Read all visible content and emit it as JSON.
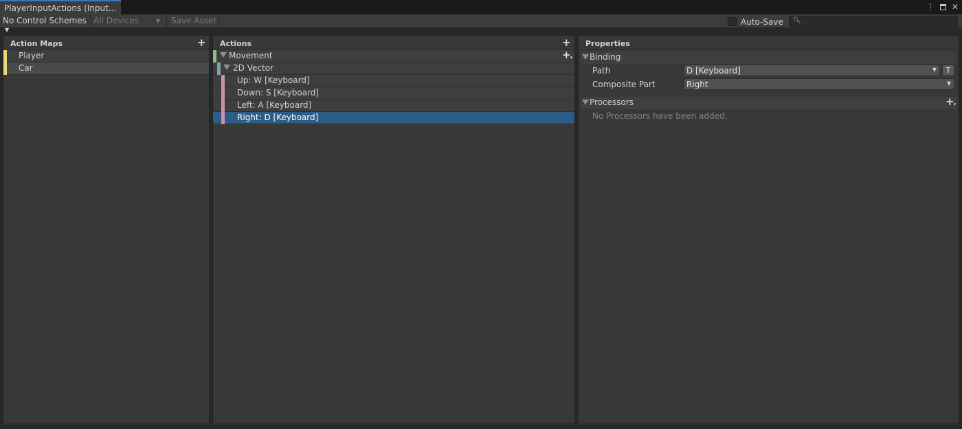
{
  "window": {
    "tab_title": "PlayerInputActions (Input...",
    "menu_icon": "vertical-ellipsis-icon",
    "maximize_icon": "maximize-icon",
    "close_icon": "close-icon",
    "menu_glyph": "⋮",
    "close_glyph": "✕"
  },
  "toolbar": {
    "control_schemes": "No Control Schemes",
    "devices": "All Devices",
    "save_asset": "Save Asset",
    "auto_save_label": "Auto-Save",
    "auto_save_checked": false,
    "search_placeholder": "",
    "search_icon": "search-icon"
  },
  "action_maps": {
    "header": "Action Maps",
    "add_icon": "plus-icon",
    "items": [
      {
        "label": "Player",
        "color": "#ead77a",
        "selected": false
      },
      {
        "label": "Car",
        "color": "#ead77a",
        "selected": true
      }
    ]
  },
  "actions": {
    "header": "Actions",
    "add_icon": "plus-icon",
    "action": {
      "label": "Movement",
      "color": "#8fbf7a",
      "add_binding_icon": "plus-dropdown-icon"
    },
    "composite": {
      "label": "2D Vector",
      "color": "#7fa4a8"
    },
    "bindings": [
      {
        "label": "Up: W [Keyboard]",
        "color": "#d08fb0",
        "selected": false
      },
      {
        "label": "Down: S [Keyboard]",
        "color": "#d08fb0",
        "selected": false
      },
      {
        "label": "Left: A [Keyboard]",
        "color": "#d08fb0",
        "selected": false
      },
      {
        "label": "Right: D [Keyboard]",
        "color": "#d08fb0",
        "selected": true
      }
    ]
  },
  "properties": {
    "header": "Properties",
    "binding_section": "Binding",
    "path_label": "Path",
    "path_value": "D [Keyboard]",
    "t_button": "T",
    "composite_part_label": "Composite Part",
    "composite_part_value": "Right",
    "processors_section": "Processors",
    "processors_add_icon": "plus-dropdown-icon",
    "processors_empty": "No Processors have been added."
  },
  "colors": {
    "selection": "#2c5d87",
    "tab_accent": "#3a79bb"
  }
}
